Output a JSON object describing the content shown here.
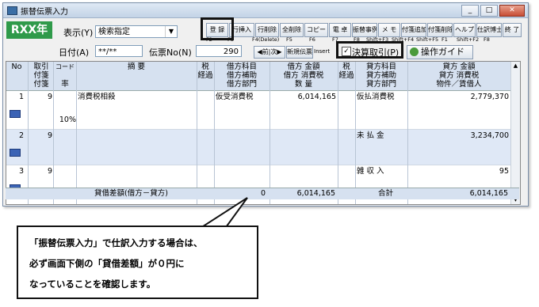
{
  "window": {
    "title": "振替伝票入力",
    "btn_min": "_",
    "btn_max": "□",
    "btn_close": "✕"
  },
  "logo": "RXX年",
  "display_label": "表示(Y)",
  "display_value": "検索指定",
  "toolbar": {
    "buttons": [
      "登 録",
      "行挿入",
      "行削除",
      "全削除",
      "コピー",
      "電 卓",
      "振替事例",
      "メ モ",
      "付箋追加",
      "付箋削除",
      "ヘルプ",
      "仕訳博士",
      "終 了"
    ],
    "keys": [
      "F2",
      "F3",
      "F4(Delete)",
      "F5",
      "F6",
      "F7",
      "F8",
      "Shift+F3",
      "Shift+F4",
      "Shift+F5",
      "F1",
      "Shift+F2",
      "F8"
    ]
  },
  "date_label": "日付(A)",
  "date_value": "**/**",
  "slip_label": "伝票No(N)",
  "slip_value": "290",
  "prev_next": "◀前|次▶",
  "new_slip": "新規伝票",
  "insert_key": "Insert",
  "settle_label": "決算取引(P)",
  "settle_check": "✓",
  "guide_label": "操作ガイド",
  "headers": {
    "no": "No",
    "torihiki": [
      "取引",
      "付箋",
      "付箋"
    ],
    "code": "コード",
    "rate": "率",
    "tekiyo": "摘 要",
    "zei": [
      "税",
      "経過"
    ],
    "debit_acct": [
      "借方科目",
      "借方補助",
      "借方部門"
    ],
    "debit_amt": [
      "借方 金額",
      "借方 消費税",
      "数 量"
    ],
    "zei2": [
      "税",
      "経過"
    ],
    "credit_acct": [
      "貸方科目",
      "貸方補助",
      "貸方部門"
    ],
    "credit_amt": [
      "貸方 金額",
      "貸方 消費税",
      "物件／賃借人"
    ]
  },
  "rows": [
    {
      "no": "1",
      "tr": "9",
      "tekiyo": "消費税相殺",
      "debit_acct": "仮受消費税",
      "debit_amt": "6,014,165",
      "credit_acct": "仮払消費税",
      "credit_amt": "2,779,370",
      "rate": "10%"
    },
    {
      "no": "2",
      "tr": "9",
      "tekiyo": "",
      "debit_acct": "",
      "debit_amt": "",
      "credit_acct": "未 払 金",
      "credit_amt": "3,234,700",
      "rate": ""
    },
    {
      "no": "3",
      "tr": "9",
      "tekiyo": "",
      "debit_acct": "",
      "debit_amt": "",
      "credit_acct": "雑 収 入",
      "credit_amt": "95",
      "rate": ""
    }
  ],
  "footer": {
    "diff_label": "貸借差額(借方－貸方)",
    "diff_value": "0",
    "debit_total": "6,014,165",
    "total_label": "合計",
    "credit_total": "6,014,165"
  },
  "callout": {
    "line1": "「振替伝票入力」で仕訳入力する場合は、",
    "line2": "必ず画面下側の「貸借差額」が０円に",
    "line3": "なっていることを確認します。"
  }
}
